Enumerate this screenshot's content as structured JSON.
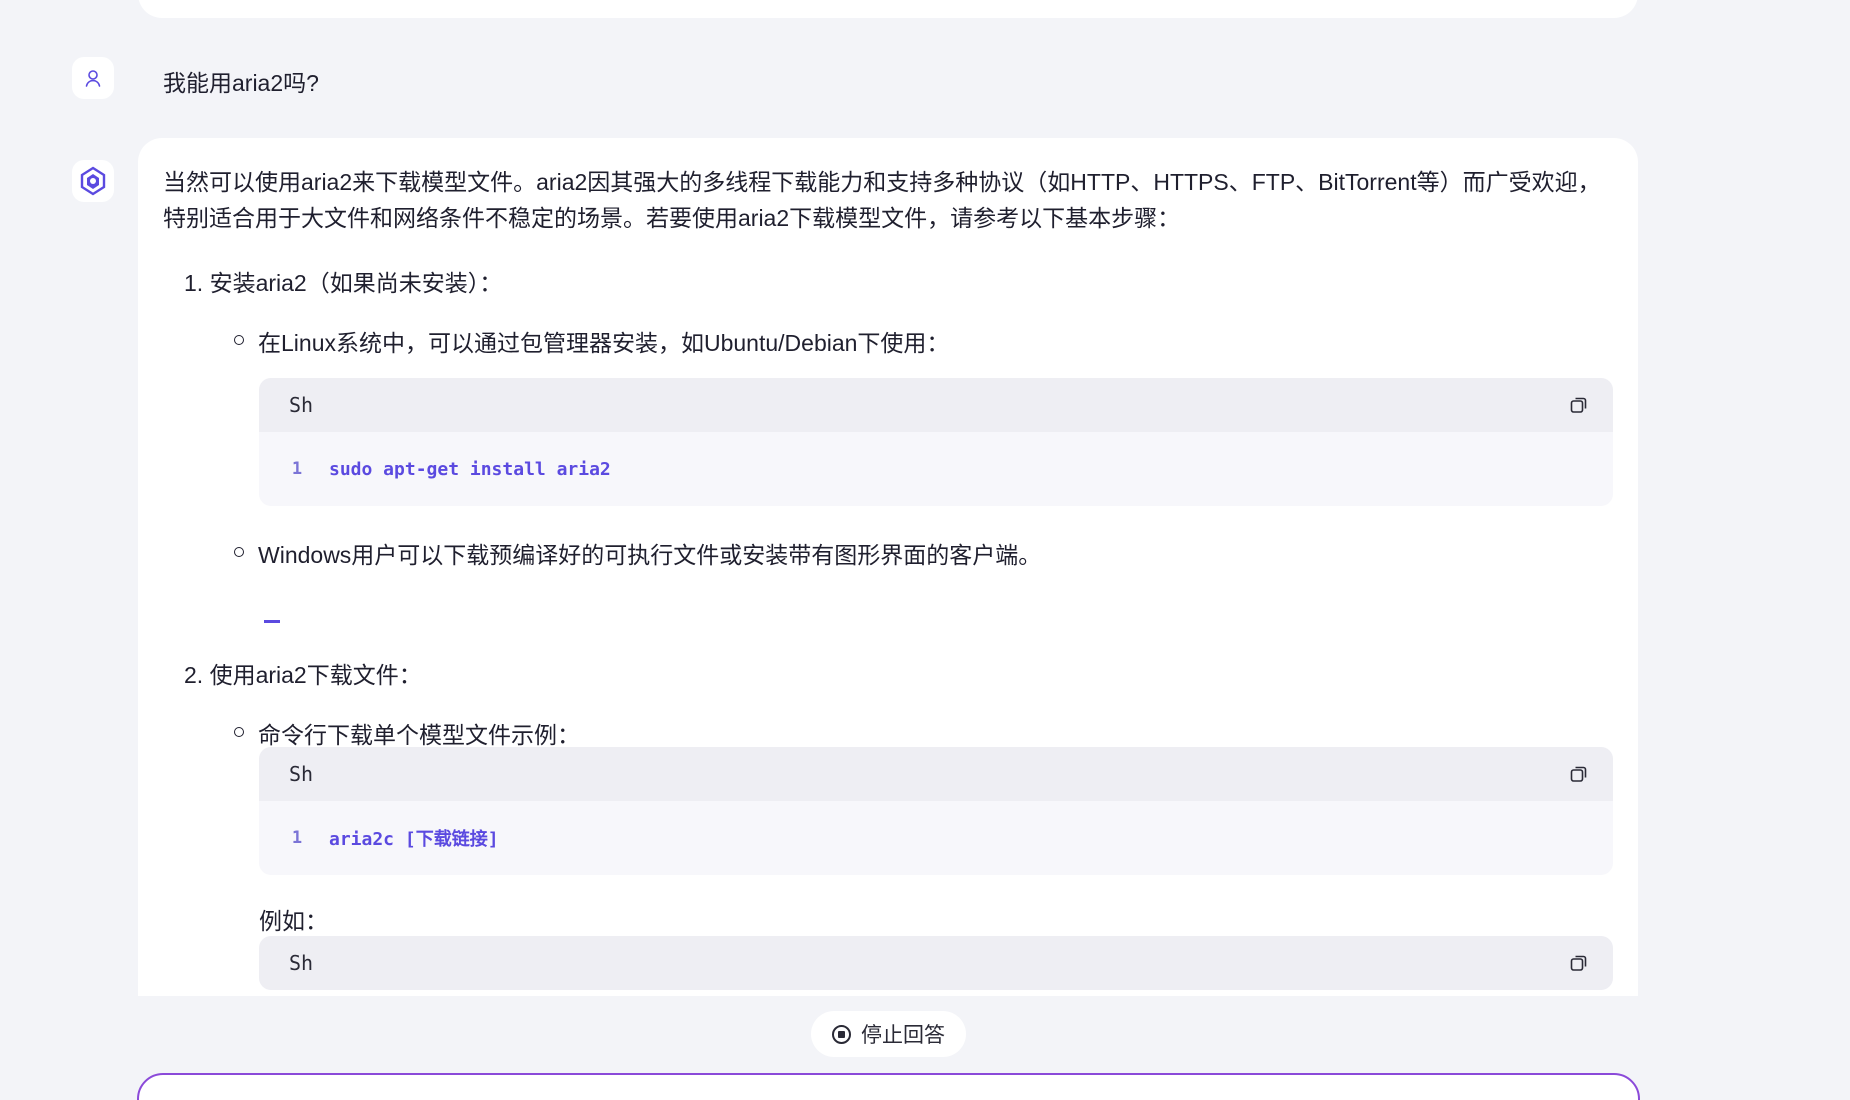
{
  "user_message": "我能用aria2吗?",
  "answer": {
    "intro": "当然可以使用aria2来下载模型文件。aria2因其强大的多线程下载能力和支持多种协议（如HTTP、HTTPS、FTP、BitTorrent等）而广受欢迎，特别适合用于大文件和网络条件不稳定的场景。若要使用aria2下载模型文件，请参考以下基本步骤：",
    "step1": "1. 安装aria2（如果尚未安装）：",
    "step1_bullet1": "在Linux系统中，可以通过包管理器安装，如Ubuntu/Debian下使用：",
    "code1": {
      "lang": "Sh",
      "line_no": "1",
      "code": "sudo apt-get install aria2"
    },
    "step1_bullet2": "Windows用户可以下载预编译好的可执行文件或安装带有图形界面的客户端。",
    "step2": "2. 使用aria2下载文件：",
    "step2_bullet1": "命令行下载单个模型文件示例：",
    "code2": {
      "lang": "Sh",
      "line_no": "1",
      "code": "aria2c [下载链接]"
    },
    "example_label": "例如：",
    "code3": {
      "lang": "Sh"
    }
  },
  "stop_button": {
    "label": "停止回答"
  },
  "input": {
    "placeholder": ""
  },
  "colors": {
    "accent": "#5b4ae0",
    "input_border": "#8b4ad9",
    "background": "#f3f4f8"
  }
}
